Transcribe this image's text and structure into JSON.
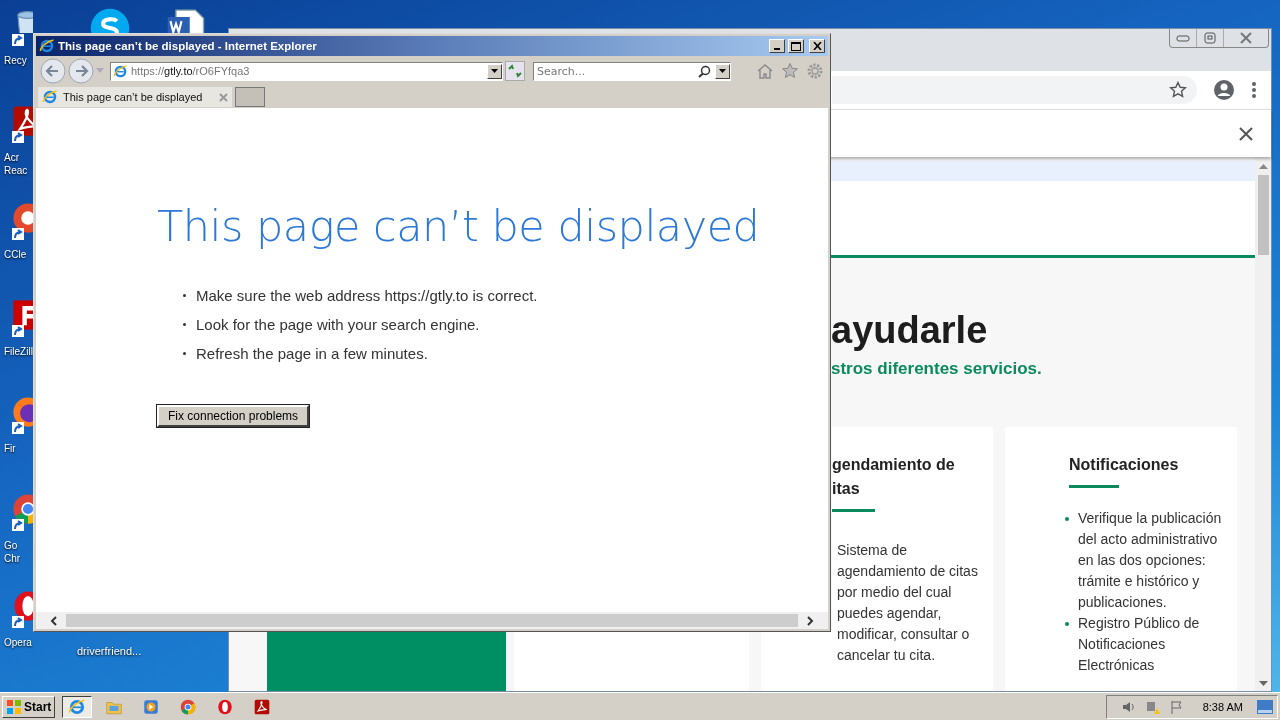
{
  "desktop": {
    "icons_left": [
      {
        "kind": "recycle",
        "label": "Recy"
      },
      {
        "kind": "acrobat",
        "label": "Acr Reac"
      },
      {
        "kind": "ccleaner",
        "label": "CCle"
      },
      {
        "kind": "filezilla",
        "label": "FileZill"
      },
      {
        "kind": "firefox",
        "label": "Fir"
      },
      {
        "kind": "chrome",
        "label": "Go Chr"
      },
      {
        "kind": "opera",
        "label": "Opera"
      }
    ],
    "icons_top": [
      {
        "kind": "skype"
      },
      {
        "kind": "word"
      }
    ],
    "driver_label": "driverfriend..."
  },
  "chrome_window": {
    "heading": "ayudarle",
    "subheading": "stros diferentes servicios.",
    "cards": [
      {
        "title_lines": [
          "gendamiento de",
          "itas"
        ],
        "text": "Sistema de agendamiento de citas por medio del cual puedes agendar, modificar, consultar o cancelar tu cita."
      },
      {
        "title_lines": [
          "Notificaciones"
        ],
        "bullets": [
          "Verifique la publicación del acto administrativo en las dos opciones: trámite e histórico y publicaciones.",
          "Registro Público de Notificaciones Electrónicas"
        ]
      }
    ]
  },
  "ie_window": {
    "title": "This page can’t be displayed - Internet Explorer",
    "address": "https://**gtly.to**/rO6FYfqa3",
    "search": {
      "placeholder": "Search..."
    },
    "tabs": [
      {
        "label": "This page can’t be displayed",
        "selected": true
      }
    ],
    "heading": "This page can’t be displayed",
    "bullets": [
      "Make sure the web address https://gtly.to is correct.",
      "Look for the page with your search engine.",
      "Refresh the page in a few minutes."
    ],
    "button": "Fix connection problems"
  },
  "taskbar": {
    "start": "Start",
    "items": [
      {
        "kind": "ie",
        "selected": true
      },
      {
        "kind": "folder",
        "selected": false
      },
      {
        "kind": "media",
        "selected": false
      },
      {
        "kind": "chrome",
        "selected": false
      },
      {
        "kind": "opera",
        "selected": false
      },
      {
        "kind": "acrobat",
        "selected": false
      }
    ],
    "clock": "8:38 AM"
  }
}
